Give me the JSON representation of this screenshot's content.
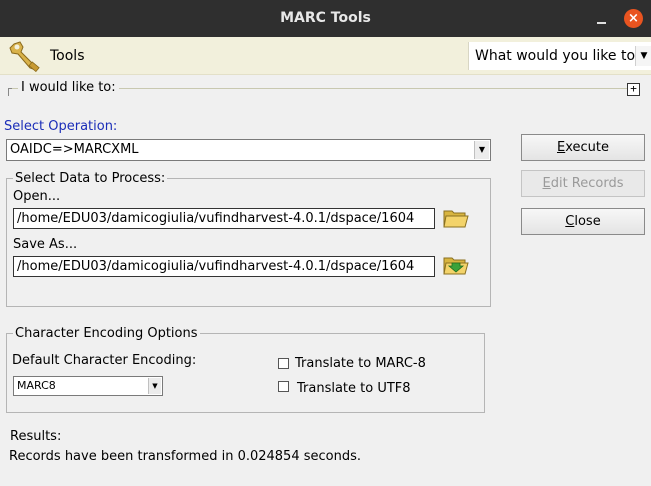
{
  "window": {
    "title": "MARC Tools",
    "close_glyph": "×"
  },
  "toolbar": {
    "tools_label": "Tools",
    "question_text": "What would you like to"
  },
  "wouldlike": {
    "label": "I would like to:",
    "expand_glyph": "+"
  },
  "operation": {
    "label": "Select Operation:",
    "selected": "OAIDC=>MARCXML"
  },
  "data_group": {
    "legend": "Select Data to Process:",
    "open_label": "Open...",
    "open_path": "/home/EDU03/damicogiulia/vufindharvest-4.0.1/dspace/1604",
    "saveas_label": "Save As...",
    "saveas_path": "/home/EDU03/damicogiulia/vufindharvest-4.0.1/dspace/1604"
  },
  "encoding_group": {
    "legend": "Character Encoding Options",
    "default_label": "Default Character Encoding:",
    "default_value": "MARC8",
    "translate_marc8": "Translate to MARC-8",
    "translate_utf8": "Translate to UTF8",
    "translate_marc8_checked": false,
    "translate_utf8_checked": false
  },
  "buttons": {
    "execute_pre": "",
    "execute_key": "E",
    "execute_post": "xecute",
    "edit_pre": "",
    "edit_key": "E",
    "edit_post": "dit Records",
    "close_pre": "",
    "close_key": "C",
    "close_post": "lose"
  },
  "results": {
    "label": "Results:",
    "message": "Records have been transformed in 0.024854 seconds."
  },
  "colors": {
    "titlebar": "#2f2f2f",
    "close_button": "#e95420",
    "toolbar_bg": "#f2f0dc",
    "operation_label": "#1a2db8"
  }
}
